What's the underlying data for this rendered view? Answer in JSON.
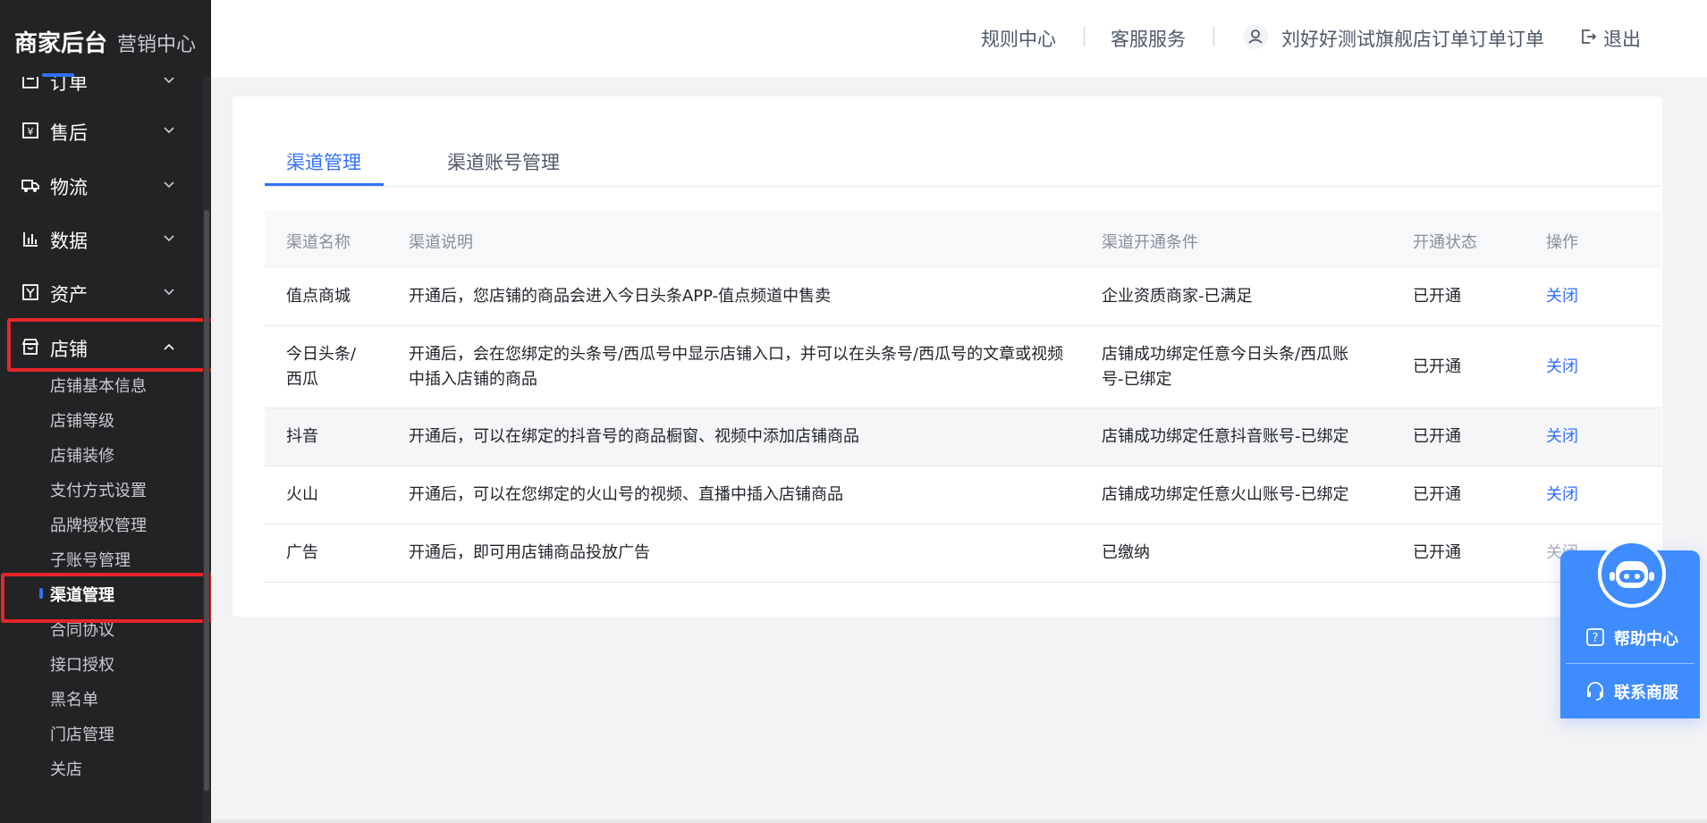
{
  "brand": {
    "title": "商家后台",
    "subtitle": "营销中心"
  },
  "sidebar": {
    "partial_item": "订单",
    "groups": [
      {
        "label": "售后",
        "icon": "yen-receipt-icon"
      },
      {
        "label": "物流",
        "icon": "truck-icon"
      },
      {
        "label": "数据",
        "icon": "bar-chart-icon"
      },
      {
        "label": "资产",
        "icon": "asset-icon"
      },
      {
        "label": "店铺",
        "icon": "store-icon"
      }
    ],
    "store_items": [
      "店铺基本信息",
      "店铺等级",
      "店铺装修",
      "支付方式设置",
      "品牌授权管理",
      "子账号管理",
      "渠道管理",
      "合同协议",
      "接口授权",
      "黑名单",
      "门店管理",
      "关店"
    ],
    "active_item": "渠道管理"
  },
  "header": {
    "rules_center": "规则中心",
    "customer_service": "客服服务",
    "user_name": "刘好好测试旗舰店订单订单订单",
    "logout": "退出"
  },
  "tabs": [
    "渠道管理",
    "渠道账号管理"
  ],
  "table": {
    "headers": [
      "渠道名称",
      "渠道说明",
      "渠道开通条件",
      "开通状态",
      "操作"
    ],
    "rows": [
      {
        "name": "值点商城",
        "desc": "开通后，您店铺的商品会进入今日头条APP-值点频道中售卖",
        "condition": "企业资质商家-已满足",
        "status": "已开通",
        "action": "关闭"
      },
      {
        "name": "今日头条/西瓜",
        "desc": "开通后，会在您绑定的头条号/西瓜号中显示店铺入口，并可以在头条号/西瓜号的文章或视频中插入店铺的商品",
        "condition": "店铺成功绑定任意今日头条/西瓜账号-已绑定",
        "status": "已开通",
        "action": "关闭"
      },
      {
        "name": "抖音",
        "desc": "开通后，可以在绑定的抖音号的商品橱窗、视频中添加店铺商品",
        "condition": "店铺成功绑定任意抖音账号-已绑定",
        "status": "已开通",
        "action": "关闭"
      },
      {
        "name": "火山",
        "desc": "开通后，可以在您绑定的火山号的视频、直播中插入店铺商品",
        "condition": "店铺成功绑定任意火山账号-已绑定",
        "status": "已开通",
        "action": "关闭"
      },
      {
        "name": "广告",
        "desc": "开通后，即可用店铺商品投放广告",
        "condition": "已缴纳",
        "status": "已开通",
        "action": "关闭"
      }
    ]
  },
  "help_widget": {
    "help_center": "帮助中心",
    "contact_service": "联系商服"
  },
  "colors": {
    "accent": "#3370ff",
    "highlight": "#e8262a",
    "sidebar_bg": "#222325"
  }
}
